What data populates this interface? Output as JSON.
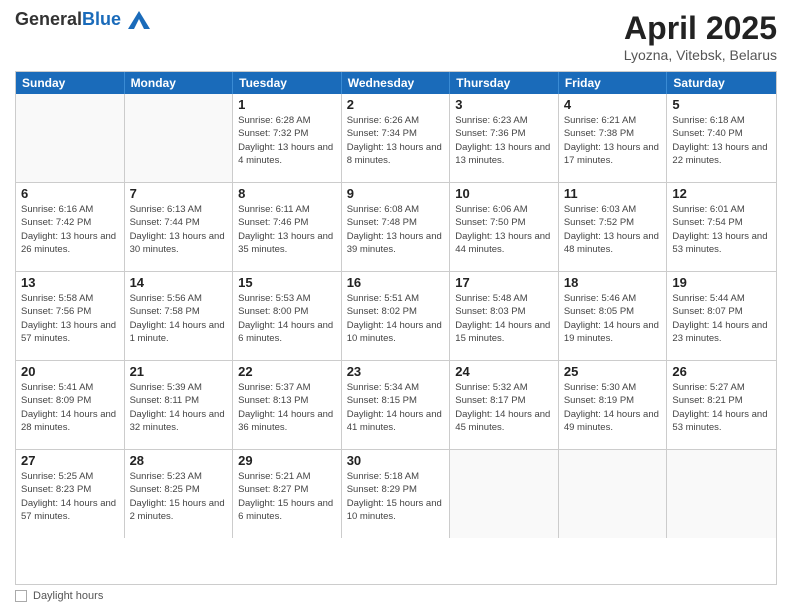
{
  "header": {
    "logo_general": "General",
    "logo_blue": "Blue",
    "month_year": "April 2025",
    "location": "Lyozna, Vitebsk, Belarus"
  },
  "days_of_week": [
    "Sunday",
    "Monday",
    "Tuesday",
    "Wednesday",
    "Thursday",
    "Friday",
    "Saturday"
  ],
  "weeks": [
    [
      {
        "day": "",
        "sunrise": "",
        "sunset": "",
        "daylight": ""
      },
      {
        "day": "",
        "sunrise": "",
        "sunset": "",
        "daylight": ""
      },
      {
        "day": "1",
        "sunrise": "Sunrise: 6:28 AM",
        "sunset": "Sunset: 7:32 PM",
        "daylight": "Daylight: 13 hours and 4 minutes."
      },
      {
        "day": "2",
        "sunrise": "Sunrise: 6:26 AM",
        "sunset": "Sunset: 7:34 PM",
        "daylight": "Daylight: 13 hours and 8 minutes."
      },
      {
        "day": "3",
        "sunrise": "Sunrise: 6:23 AM",
        "sunset": "Sunset: 7:36 PM",
        "daylight": "Daylight: 13 hours and 13 minutes."
      },
      {
        "day": "4",
        "sunrise": "Sunrise: 6:21 AM",
        "sunset": "Sunset: 7:38 PM",
        "daylight": "Daylight: 13 hours and 17 minutes."
      },
      {
        "day": "5",
        "sunrise": "Sunrise: 6:18 AM",
        "sunset": "Sunset: 7:40 PM",
        "daylight": "Daylight: 13 hours and 22 minutes."
      }
    ],
    [
      {
        "day": "6",
        "sunrise": "Sunrise: 6:16 AM",
        "sunset": "Sunset: 7:42 PM",
        "daylight": "Daylight: 13 hours and 26 minutes."
      },
      {
        "day": "7",
        "sunrise": "Sunrise: 6:13 AM",
        "sunset": "Sunset: 7:44 PM",
        "daylight": "Daylight: 13 hours and 30 minutes."
      },
      {
        "day": "8",
        "sunrise": "Sunrise: 6:11 AM",
        "sunset": "Sunset: 7:46 PM",
        "daylight": "Daylight: 13 hours and 35 minutes."
      },
      {
        "day": "9",
        "sunrise": "Sunrise: 6:08 AM",
        "sunset": "Sunset: 7:48 PM",
        "daylight": "Daylight: 13 hours and 39 minutes."
      },
      {
        "day": "10",
        "sunrise": "Sunrise: 6:06 AM",
        "sunset": "Sunset: 7:50 PM",
        "daylight": "Daylight: 13 hours and 44 minutes."
      },
      {
        "day": "11",
        "sunrise": "Sunrise: 6:03 AM",
        "sunset": "Sunset: 7:52 PM",
        "daylight": "Daylight: 13 hours and 48 minutes."
      },
      {
        "day": "12",
        "sunrise": "Sunrise: 6:01 AM",
        "sunset": "Sunset: 7:54 PM",
        "daylight": "Daylight: 13 hours and 53 minutes."
      }
    ],
    [
      {
        "day": "13",
        "sunrise": "Sunrise: 5:58 AM",
        "sunset": "Sunset: 7:56 PM",
        "daylight": "Daylight: 13 hours and 57 minutes."
      },
      {
        "day": "14",
        "sunrise": "Sunrise: 5:56 AM",
        "sunset": "Sunset: 7:58 PM",
        "daylight": "Daylight: 14 hours and 1 minute."
      },
      {
        "day": "15",
        "sunrise": "Sunrise: 5:53 AM",
        "sunset": "Sunset: 8:00 PM",
        "daylight": "Daylight: 14 hours and 6 minutes."
      },
      {
        "day": "16",
        "sunrise": "Sunrise: 5:51 AM",
        "sunset": "Sunset: 8:02 PM",
        "daylight": "Daylight: 14 hours and 10 minutes."
      },
      {
        "day": "17",
        "sunrise": "Sunrise: 5:48 AM",
        "sunset": "Sunset: 8:03 PM",
        "daylight": "Daylight: 14 hours and 15 minutes."
      },
      {
        "day": "18",
        "sunrise": "Sunrise: 5:46 AM",
        "sunset": "Sunset: 8:05 PM",
        "daylight": "Daylight: 14 hours and 19 minutes."
      },
      {
        "day": "19",
        "sunrise": "Sunrise: 5:44 AM",
        "sunset": "Sunset: 8:07 PM",
        "daylight": "Daylight: 14 hours and 23 minutes."
      }
    ],
    [
      {
        "day": "20",
        "sunrise": "Sunrise: 5:41 AM",
        "sunset": "Sunset: 8:09 PM",
        "daylight": "Daylight: 14 hours and 28 minutes."
      },
      {
        "day": "21",
        "sunrise": "Sunrise: 5:39 AM",
        "sunset": "Sunset: 8:11 PM",
        "daylight": "Daylight: 14 hours and 32 minutes."
      },
      {
        "day": "22",
        "sunrise": "Sunrise: 5:37 AM",
        "sunset": "Sunset: 8:13 PM",
        "daylight": "Daylight: 14 hours and 36 minutes."
      },
      {
        "day": "23",
        "sunrise": "Sunrise: 5:34 AM",
        "sunset": "Sunset: 8:15 PM",
        "daylight": "Daylight: 14 hours and 41 minutes."
      },
      {
        "day": "24",
        "sunrise": "Sunrise: 5:32 AM",
        "sunset": "Sunset: 8:17 PM",
        "daylight": "Daylight: 14 hours and 45 minutes."
      },
      {
        "day": "25",
        "sunrise": "Sunrise: 5:30 AM",
        "sunset": "Sunset: 8:19 PM",
        "daylight": "Daylight: 14 hours and 49 minutes."
      },
      {
        "day": "26",
        "sunrise": "Sunrise: 5:27 AM",
        "sunset": "Sunset: 8:21 PM",
        "daylight": "Daylight: 14 hours and 53 minutes."
      }
    ],
    [
      {
        "day": "27",
        "sunrise": "Sunrise: 5:25 AM",
        "sunset": "Sunset: 8:23 PM",
        "daylight": "Daylight: 14 hours and 57 minutes."
      },
      {
        "day": "28",
        "sunrise": "Sunrise: 5:23 AM",
        "sunset": "Sunset: 8:25 PM",
        "daylight": "Daylight: 15 hours and 2 minutes."
      },
      {
        "day": "29",
        "sunrise": "Sunrise: 5:21 AM",
        "sunset": "Sunset: 8:27 PM",
        "daylight": "Daylight: 15 hours and 6 minutes."
      },
      {
        "day": "30",
        "sunrise": "Sunrise: 5:18 AM",
        "sunset": "Sunset: 8:29 PM",
        "daylight": "Daylight: 15 hours and 10 minutes."
      },
      {
        "day": "",
        "sunrise": "",
        "sunset": "",
        "daylight": ""
      },
      {
        "day": "",
        "sunrise": "",
        "sunset": "",
        "daylight": ""
      },
      {
        "day": "",
        "sunrise": "",
        "sunset": "",
        "daylight": ""
      }
    ]
  ],
  "footer": {
    "label": "Daylight hours"
  }
}
